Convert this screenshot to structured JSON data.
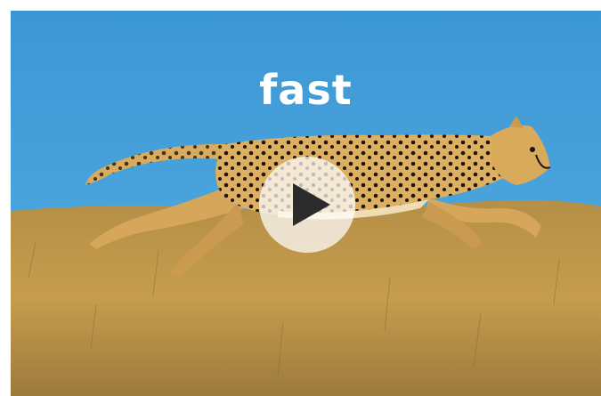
{
  "video": {
    "title": "fast",
    "thumbnail_icon": "cheetah-running-image",
    "play_icon": "play-icon"
  },
  "colors": {
    "sky": "#3f9bd7",
    "grass": "#c39a45",
    "cheetah": "#d7a657",
    "spots": "#1e1610",
    "play_overlay": "#ffffff",
    "play_triangle": "#2b2b2b",
    "title_text": "#ffffff"
  }
}
